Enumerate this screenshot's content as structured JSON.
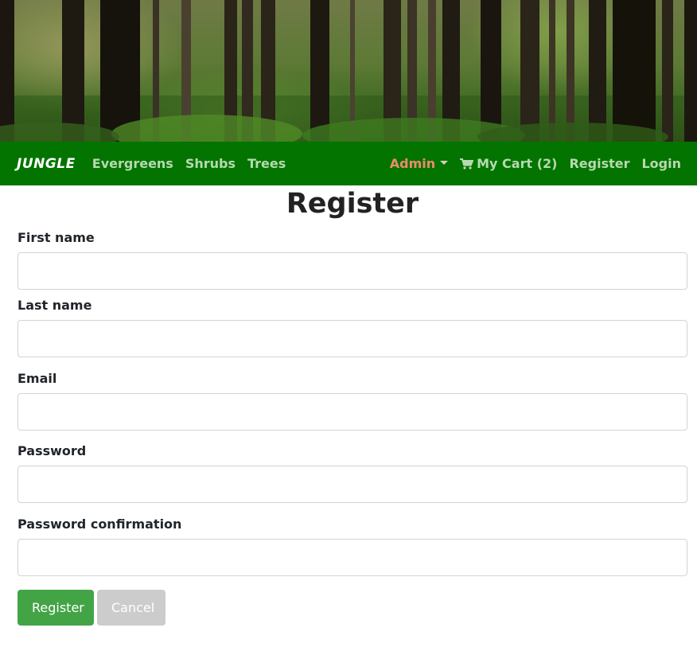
{
  "navbar": {
    "brand": "JUNGLE",
    "links": [
      "Evergreens",
      "Shrubs",
      "Trees"
    ],
    "admin_label": "Admin",
    "cart_label": "My Cart (2)",
    "register_label": "Register",
    "login_label": "Login",
    "colors": {
      "background": "#037400",
      "link": "#b7d9b0",
      "admin": "#ee8a6e"
    }
  },
  "page": {
    "title": "Register"
  },
  "form": {
    "fields": [
      {
        "label": "First name",
        "value": "",
        "type": "text"
      },
      {
        "label": "Last name",
        "value": "",
        "type": "text"
      },
      {
        "label": "Email",
        "value": "",
        "type": "email"
      },
      {
        "label": "Password",
        "value": "",
        "type": "password"
      },
      {
        "label": "Password confirmation",
        "value": "",
        "type": "password"
      }
    ],
    "submit_label": "Register",
    "cancel_label": "Cancel",
    "colors": {
      "submit": "#43a446",
      "cancel": "#cccccc"
    }
  }
}
